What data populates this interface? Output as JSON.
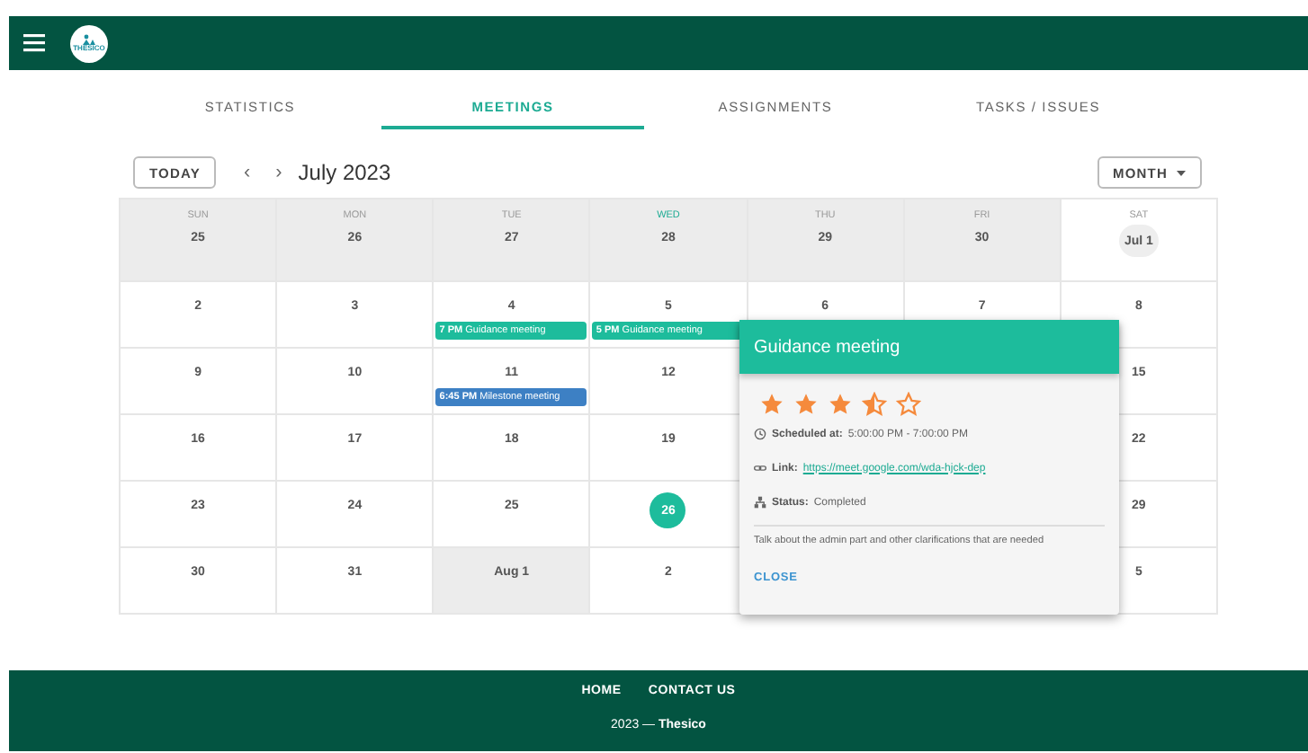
{
  "header": {
    "logo_text": "THESICO"
  },
  "tabs": [
    {
      "label": "STATISTICS",
      "selected": false
    },
    {
      "label": "MEETINGS",
      "selected": true
    },
    {
      "label": "ASSIGNMENTS",
      "selected": false
    },
    {
      "label": "TASKS / ISSUES",
      "selected": false
    }
  ],
  "toolbar": {
    "today_button": "TODAY",
    "prev": "‹",
    "next": "›",
    "title": "July 2023",
    "view_button": "MONTH"
  },
  "calendar": {
    "weekdays": [
      {
        "label": "SUN",
        "current": false
      },
      {
        "label": "MON",
        "current": false
      },
      {
        "label": "TUE",
        "current": false
      },
      {
        "label": "WED",
        "current": true
      },
      {
        "label": "THU",
        "current": false
      },
      {
        "label": "FRI",
        "current": false
      },
      {
        "label": "SAT",
        "current": false
      }
    ],
    "weeks": [
      [
        {
          "label": "25",
          "outside": true
        },
        {
          "label": "26",
          "outside": true
        },
        {
          "label": "27",
          "outside": true
        },
        {
          "label": "28",
          "outside": true
        },
        {
          "label": "29",
          "outside": true
        },
        {
          "label": "30",
          "outside": true
        },
        {
          "label": "Jul 1",
          "outside": false,
          "hovered": true
        }
      ],
      [
        {
          "label": "2",
          "outside": false
        },
        {
          "label": "3",
          "outside": false
        },
        {
          "label": "4",
          "outside": false,
          "events": [
            {
              "time": "7 PM",
              "title": "Guidance meeting",
              "color": "#1dbc9c"
            }
          ]
        },
        {
          "label": "5",
          "outside": false,
          "events": [
            {
              "time": "5 PM",
              "title": "Guidance meeting",
              "color": "#1dbc9c"
            }
          ]
        },
        {
          "label": "6",
          "outside": false
        },
        {
          "label": "7",
          "outside": false
        },
        {
          "label": "8",
          "outside": false
        }
      ],
      [
        {
          "label": "9",
          "outside": false
        },
        {
          "label": "10",
          "outside": false
        },
        {
          "label": "11",
          "outside": false,
          "events": [
            {
              "time": "6:45 PM",
              "title": "Milestone meeting",
              "color": "#3d80c4"
            }
          ]
        },
        {
          "label": "12",
          "outside": false
        },
        {
          "label": "15",
          "outside": false
        }
      ],
      [
        {
          "label": "16",
          "outside": false
        },
        {
          "label": "17",
          "outside": false
        },
        {
          "label": "18",
          "outside": false
        },
        {
          "label": "19",
          "outside": false
        },
        {
          "label": "22",
          "outside": false
        }
      ],
      [
        {
          "label": "23",
          "outside": false
        },
        {
          "label": "24",
          "outside": false
        },
        {
          "label": "25",
          "outside": false
        },
        {
          "label": "26",
          "outside": false,
          "today": true
        },
        {
          "label": "29",
          "outside": false
        }
      ],
      [
        {
          "label": "30",
          "outside": false
        },
        {
          "label": "31",
          "outside": false
        },
        {
          "label": "Aug 1",
          "outside": true
        },
        {
          "label": "2",
          "outside": false
        },
        {
          "label": "5",
          "outside": false
        }
      ]
    ]
  },
  "popup": {
    "title": "Guidance meeting",
    "stars": 3.5,
    "fields": [
      {
        "kind": "time",
        "label": "Scheduled at:",
        "value": "5:00:00 PM - 7:00:00 PM"
      },
      {
        "kind": "link",
        "label": "Link:",
        "value": "https://meet.google.com/wda-hjck-dep"
      },
      {
        "kind": "status",
        "label": "Status:",
        "value": "Completed"
      }
    ],
    "description": "Talk about the admin part and other clarifications that are needed",
    "close_button": "CLOSE"
  },
  "footer": {
    "links": [
      "HOME",
      "CONTACT US"
    ],
    "copyright": "2023 — **Thesico**"
  }
}
